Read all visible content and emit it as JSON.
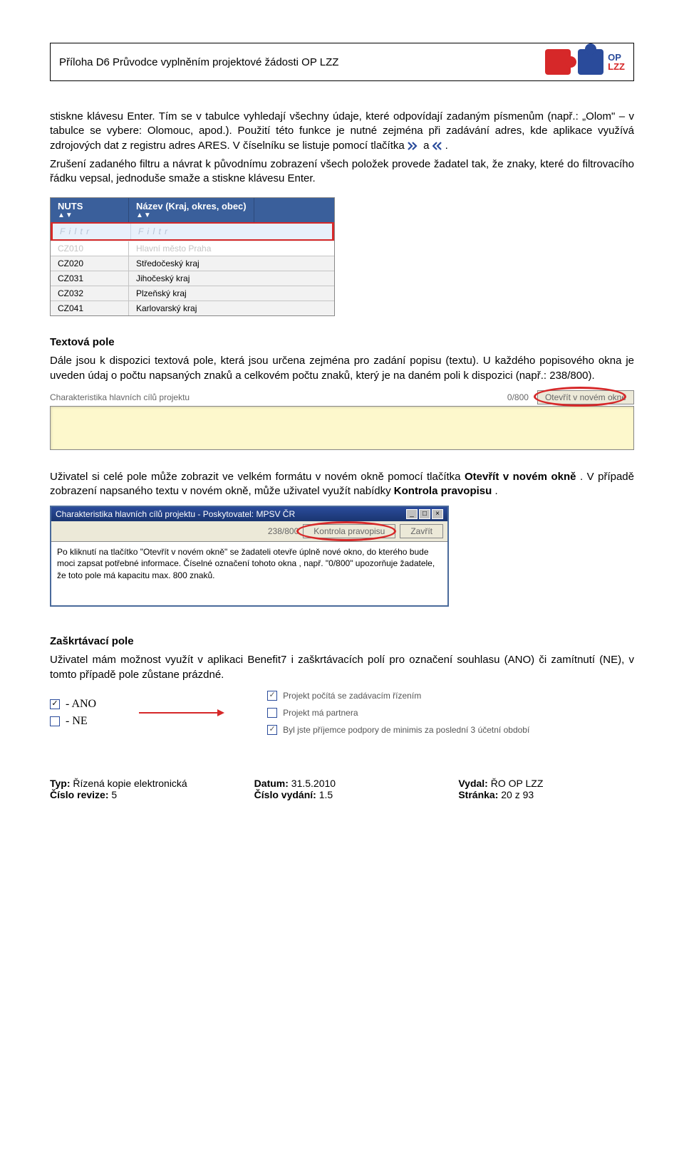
{
  "header": {
    "title": "Příloha D6 Průvodce vyplněním projektové žádosti OP LZZ",
    "logo_op": "OP",
    "logo_lzz": "LZZ"
  },
  "p1": "stiskne klávesu Enter. Tím se v tabulce vyhledají všechny údaje, které odpovídají zadaným písmenům (např.: „Olom\" – v tabulce se vybere: Olomouc, apod.). Použití této funkce je nutné zejména při zadávání adres, kde aplikace využívá zdrojových dat z registru adres ARES. V číselníku se listuje pomocí tlačítka ",
  "p1b": " a ",
  "p1c": ".",
  "p2": "Zrušení zadaného filtru a návrat k původnímu zobrazení všech položek provede žadatel tak, že znaky, které do filtrovacího řádku vepsal, jednoduše smaže a stiskne klávesu Enter.",
  "table1": {
    "head_col1": "NUTS",
    "head_col2": "Název (Kraj, okres, obec)",
    "sort": "▲▼",
    "filter_placeholder": "F i l t r",
    "rows": [
      {
        "c1": "CZ010",
        "c2": "Hlavní město Praha"
      },
      {
        "c1": "CZ020",
        "c2": "Středočeský kraj"
      },
      {
        "c1": "CZ031",
        "c2": "Jihočeský kraj"
      },
      {
        "c1": "CZ032",
        "c2": "Plzeňský kraj"
      },
      {
        "c1": "CZ041",
        "c2": "Karlovarský kraj"
      }
    ]
  },
  "sec1_title": "Textová pole",
  "p3": "Dále jsou k dispozici textová pole, která jsou určena zejména pro zadání popisu (textu). U každého popisového okna je uveden údaj o počtu napsaných znaků a celkovém počtu znaků, který je na daném poli k dispozici (např.: 238/800).",
  "scr2": {
    "label": "Charakteristika hlavních cílů projektu",
    "count": "0/800",
    "open_btn": "Otevřít v novém okně"
  },
  "p4a": "Uživatel si celé pole může zobrazit ve velkém formátu v novém okně pomocí tlačítka ",
  "p4b": "Otevřít v novém okně",
  "p4c": ". V případě zobrazení napsaného textu v novém okně, může uživatel využít nabídky ",
  "p4d": "Kontrola pravopisu",
  "p4e": ".",
  "scr3": {
    "title": "Charakteristika hlavních cílů projektu - Poskytovatel: MPSV ČR",
    "count": "238/800",
    "btn1": "Kontrola pravopisu",
    "btn2": "Zavřít",
    "body": "Po kliknutí na tlačítko \"Otevřít v novém okně\" se žadateli otevře úplně nové okno, do kterého bude moci zapsat potřebné informace. Číselné označení tohoto okna , např. \"0/800\" upozorňuje žadatele, že toto pole má kapacitu max. 800 znaků."
  },
  "sec2_title": "Zaškrtávací pole",
  "p5": "Uživatel mám možnost využít v aplikaci Benefit7 i zaškrtávacích polí pro označení souhlasu (ANO) či zamítnutí (NE), v tomto případě pole zůstane prázdné.",
  "yesno": {
    "ano": "- ANO",
    "ne": "- NE"
  },
  "checklist": {
    "i1": "Projekt počítá se zadávacím řízením",
    "i2": "Projekt má partnera",
    "i3": "Byl jste příjemce podpory de minimis za poslední 3 účetní období"
  },
  "footer": {
    "l1a": "Typ: ",
    "l1b": "Řízená kopie elektronická",
    "l2a": "Číslo revize: ",
    "l2b": "5",
    "m1a": "Datum: ",
    "m1b": "31.5.2010",
    "m2a": "Číslo vydání: ",
    "m2b": "1.5",
    "r1a": "Vydal: ",
    "r1b": "ŘO OP LZZ",
    "r2a": "Stránka: ",
    "r2b": "20 z 93"
  }
}
